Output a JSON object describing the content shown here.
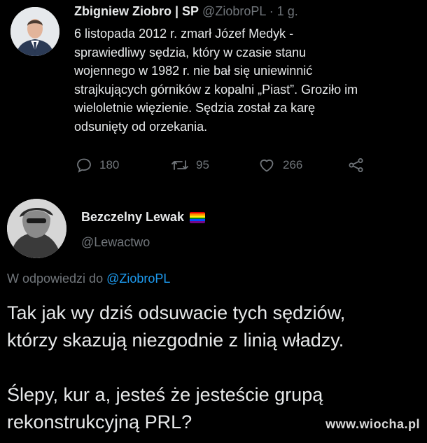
{
  "tweet": {
    "author_name": "Zbigniew Ziobro | SP",
    "meta": "@ZiobroPL · 1 g.",
    "text": "6 listopada 2012 r. zmarł Józef Medyk -\nsprawiedliwy sędzia, który w czasie stanu\nwojennego w 1982 r. nie bał się uniewinnić\nstrajkujących górników z kopalni „Piast”. Groziło im\nwieloletnie więzienie. Sędzia został za karę\nodsunięty od orzekania.",
    "actions": {
      "reply_count": "180",
      "retweet_count": "95",
      "like_count": "266"
    },
    "icons": [
      "reply-icon",
      "retweet-icon",
      "like-icon",
      "share-icon"
    ]
  },
  "reply": {
    "author_name": "Bezczelny Lewak",
    "handle": "@Lewactwo",
    "reply_to_prefix": "W odpowiedzi do ",
    "reply_to_handle": "@ZiobroPL",
    "text": "Tak jak wy dziś odsuwacie tych sędziów,\nktórzy skazują niezgodnie z linią władzy.\n\nŚlepy, kur  a, jesteś że jesteście grupą\nrekonstrukcyjną PRL?",
    "flag_colors": [
      "#e40303",
      "#ff8c00",
      "#ffed00",
      "#008026",
      "#004dff",
      "#750787"
    ]
  },
  "watermark": "www.wiocha.pl",
  "colors": {
    "background": "#000000",
    "text": "#e7e9ea",
    "secondary": "#71767b",
    "link": "#1d9bf0"
  }
}
